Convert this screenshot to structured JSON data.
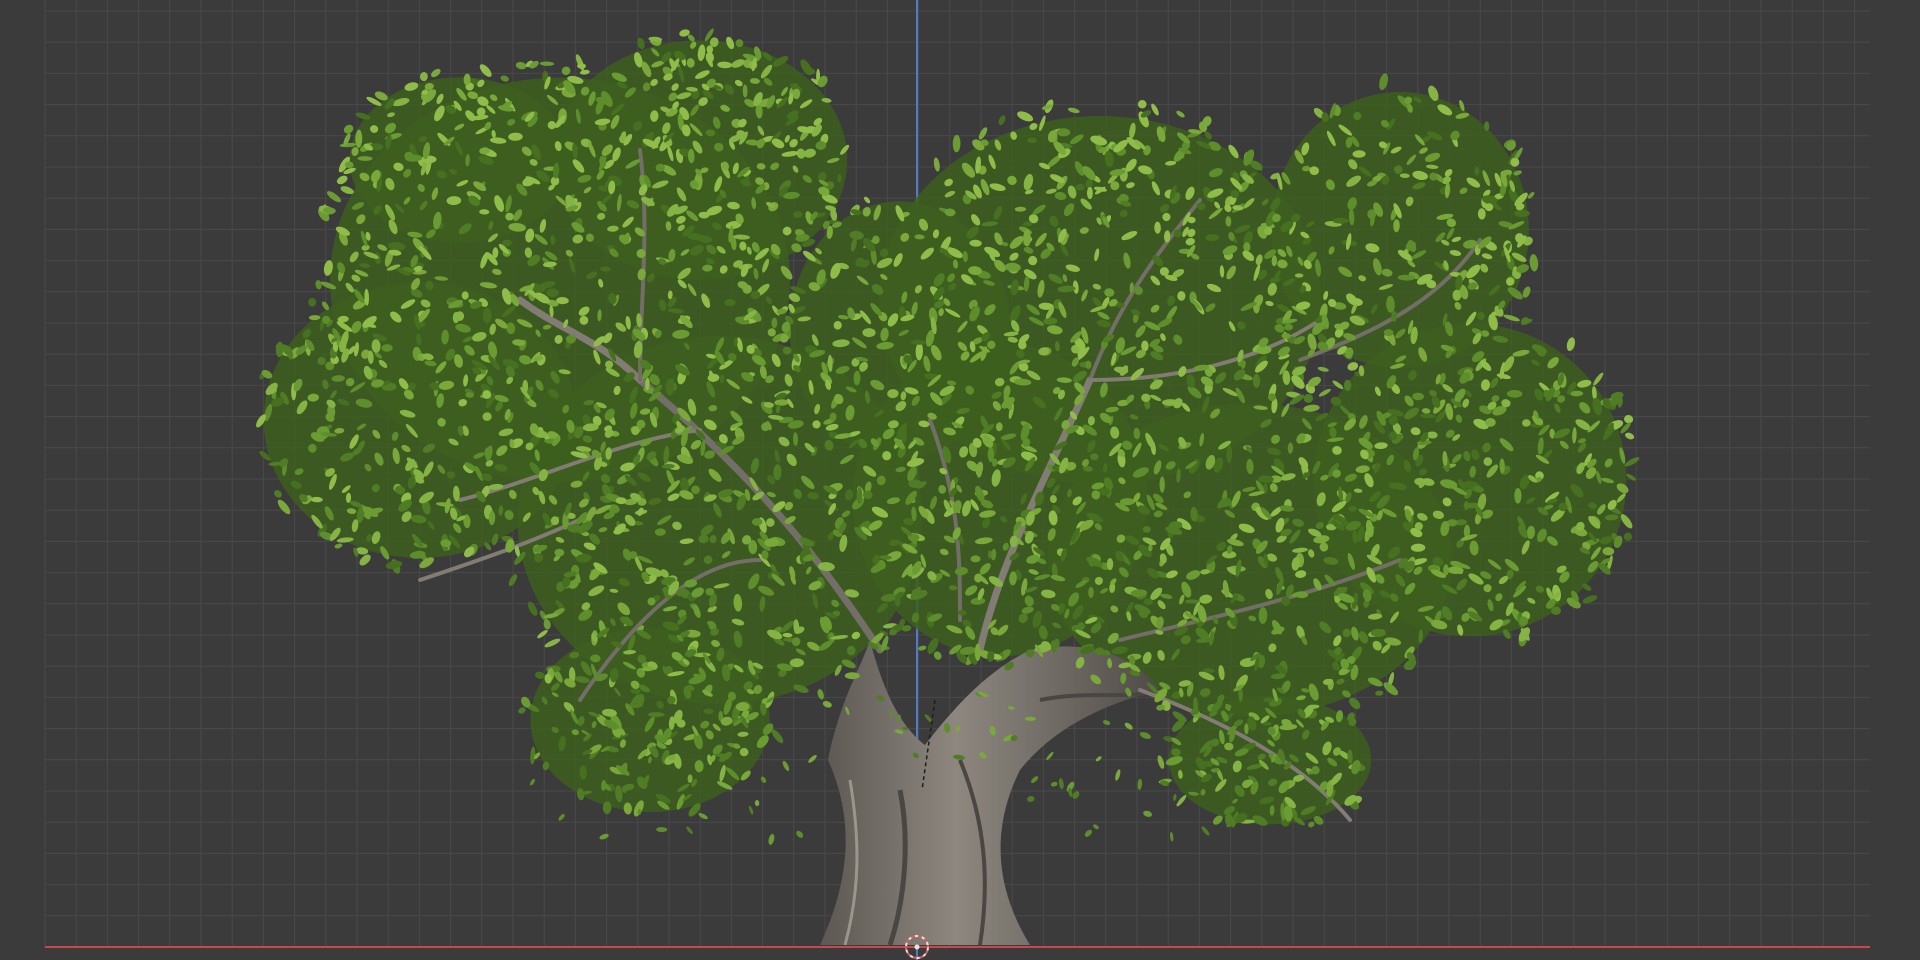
{
  "viewport": {
    "mode": "front-orthographic",
    "object": "tree-model",
    "grid": true,
    "axes": {
      "vertical_axis": "z",
      "horizontal_axis": "x"
    }
  },
  "colors": {
    "background": "#3b3b3b",
    "grid_line": "#4a4a4a",
    "grid_major": "#505050",
    "z_axis": "#4f7cc9",
    "x_axis": "#c9484f",
    "foliage_dark": "#3d5f1e",
    "foliage_mid": "#5b8a2a",
    "foliage_light": "#7aa53a",
    "bark_dark": "#5a5550",
    "bark_light": "#8a847c",
    "origin_cursor": "#e05a5a"
  },
  "icons": {
    "cursor": "3d-cursor-icon",
    "origin": "object-origin-icon"
  }
}
